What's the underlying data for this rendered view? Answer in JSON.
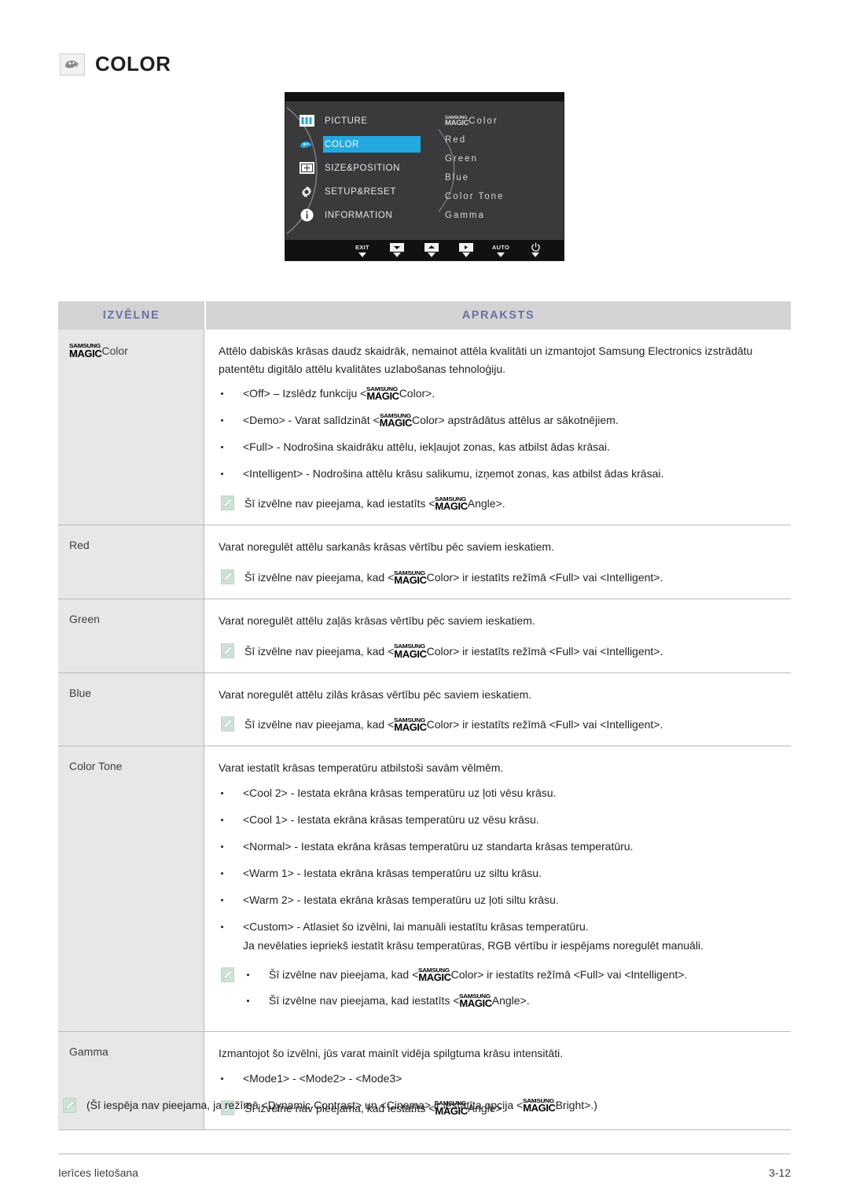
{
  "heading": {
    "icon": "color-menu-icon",
    "title": "COLOR"
  },
  "osd": {
    "left_menu": [
      {
        "icon": "picture-icon",
        "label": "PICTURE",
        "selected": false
      },
      {
        "icon": "color-icon",
        "label": "COLOR",
        "selected": true
      },
      {
        "icon": "size-position-icon",
        "label": "SIZE&POSITION",
        "selected": false
      },
      {
        "icon": "setup-reset-icon",
        "label": "SETUP&RESET",
        "selected": false
      },
      {
        "icon": "information-icon",
        "label": "INFORMATION",
        "selected": false
      }
    ],
    "submenu": [
      {
        "logo_line1": "SAMSUNG",
        "logo_line2": "MAGIC",
        "label": "Color"
      },
      {
        "label": "Red"
      },
      {
        "label": "Green"
      },
      {
        "label": "Blue"
      },
      {
        "label": "Color Tone"
      },
      {
        "label": "Gamma"
      }
    ],
    "buttons": [
      {
        "name": "exit-button",
        "type": "text",
        "label": "EXIT"
      },
      {
        "name": "down-button",
        "type": "glyph",
        "label": "▼"
      },
      {
        "name": "up-button",
        "type": "glyph",
        "label": "▲"
      },
      {
        "name": "enter-button",
        "type": "glyph",
        "label": "▶"
      },
      {
        "name": "auto-button",
        "type": "text",
        "label": "AUTO"
      },
      {
        "name": "power-button",
        "type": "glyph",
        "label": "⏻"
      }
    ],
    "highlight_color": "#23a8e0"
  },
  "table": {
    "headers": {
      "menu": "IZVĒLNE",
      "desc": "APRAKSTS"
    },
    "header_text_color": "#6b6fa6",
    "rows": [
      {
        "menu_is_logo": true,
        "menu_logo_line1": "SAMSUNG",
        "menu_logo_line2": "MAGIC",
        "menu_label": "Color",
        "paragraphs": [
          "Attēlo dabiskās krāsas daudz skaidrāk, nemainot attēla kvalitāti un izmantojot Samsung Electronics izstrādātu patentētu digitālo attēlu kvalitātes uzlabošanas tehnoloģiju."
        ],
        "bullets": [
          {
            "pre": "<Off> – Izslēdz funkciju <",
            "logo": true,
            "post": "Color>."
          },
          {
            "pre": "<Demo> - Varat salīdzināt <",
            "logo": true,
            "post": "Color> apstrādātus attēlus ar sākotnējiem."
          },
          {
            "pre": "<Full> - Nodrošina skaidrāku attēlu, iekļaujot zonas, kas atbilst ādas krāsai.",
            "logo": false,
            "post": ""
          },
          {
            "pre": "<Intelligent> - Nodrošina attēlu krāsu salikumu, izņemot zonas, kas atbilst ādas krāsai.",
            "logo": false,
            "post": ""
          }
        ],
        "note": {
          "pre": "Šī izvēlne nav pieejama, kad iestatīts <",
          "logo": true,
          "post": "Angle>."
        }
      },
      {
        "menu_is_logo": false,
        "menu_label": "Red",
        "paragraphs": [
          "Varat noregulēt attēlu sarkanās krāsas vērtību pēc saviem ieskatiem."
        ],
        "bullets": [],
        "note": {
          "pre": "Šī izvēlne nav pieejama, kad <",
          "logo": true,
          "post": "Color> ir iestatīts režīmā <Full> vai <Intelligent>."
        }
      },
      {
        "menu_is_logo": false,
        "menu_label": "Green",
        "paragraphs": [
          "Varat noregulēt attēlu zaļās krāsas vērtību pēc saviem ieskatiem."
        ],
        "bullets": [],
        "note": {
          "pre": "Šī izvēlne nav pieejama, kad <",
          "logo": true,
          "post": "Color> ir iestatīts režīmā <Full> vai <Intelligent>."
        }
      },
      {
        "menu_is_logo": false,
        "menu_label": "Blue",
        "paragraphs": [
          "Varat noregulēt attēlu zilās krāsas vērtību pēc saviem ieskatiem."
        ],
        "bullets": [],
        "note": {
          "pre": "Šī izvēlne nav pieejama, kad <",
          "logo": true,
          "post": "Color> ir iestatīts režīmā <Full> vai <Intelligent>."
        }
      },
      {
        "menu_is_logo": false,
        "menu_label": "Color Tone",
        "paragraphs": [
          "Varat iestatīt krāsas temperatūru atbilstoši savām vēlmēm."
        ],
        "bullets": [
          {
            "pre": "<Cool 2> - Iestata ekrāna krāsas temperatūru uz ļoti vēsu krāsu.",
            "logo": false,
            "post": ""
          },
          {
            "pre": "<Cool 1> - Iestata ekrāna krāsas temperatūru uz vēsu krāsu.",
            "logo": false,
            "post": ""
          },
          {
            "pre": "<Normal> - Iestata ekrāna krāsas temperatūru uz standarta krāsas temperatūru.",
            "logo": false,
            "post": ""
          },
          {
            "pre": "<Warm 1> - Iestata ekrāna krāsas temperatūru uz siltu krāsu.",
            "logo": false,
            "post": ""
          },
          {
            "pre": "<Warm 2> - Iestata ekrāna krāsas temperatūru uz ļoti siltu krāsu.",
            "logo": false,
            "post": ""
          },
          {
            "pre": "<Custom> - Atlasiet šo izvēlni, lai manuāli iestatītu krāsas temperatūru.",
            "logo": false,
            "post": ""
          }
        ],
        "extra_line": "Ja nevēlaties iepriekš iestatīt krāsu temperatūras, RGB vērtību ir iespējams noregulēt manuāli.",
        "note_bullets": [
          {
            "pre": "Šī izvēlne nav pieejama, kad <",
            "logo": true,
            "post": "Color> ir iestatīts režīmā <Full> vai <Intelligent>."
          },
          {
            "pre": "Šī izvēlne nav pieejama, kad iestatīts <",
            "logo": true,
            "post": "Angle>."
          }
        ]
      },
      {
        "menu_is_logo": false,
        "menu_label": "Gamma",
        "paragraphs": [
          "Izmantojot šo izvēlni, jūs varat mainīt vidēja spilgtuma krāsu intensitāti."
        ],
        "bullets": [
          {
            "pre": "<Mode1> - <Mode2> - <Mode3>",
            "logo": false,
            "post": ""
          }
        ],
        "note": {
          "pre": "Šī izvēlne nav pieejama, kad iestatīts <",
          "logo": true,
          "post": "Angle>."
        }
      }
    ]
  },
  "footnote": {
    "pre": "(Šī iespēja nav pieejama, ja režīmā <Dynamic Contrast> un <Cinema> ir iestatīta opcija <",
    "logo": true,
    "post": "Bright>.)"
  },
  "page_footer": {
    "left": "Ierīces lietošana",
    "right": "3-12"
  },
  "logo": {
    "line1": "SAMSUNG",
    "line2": "MAGIC"
  }
}
